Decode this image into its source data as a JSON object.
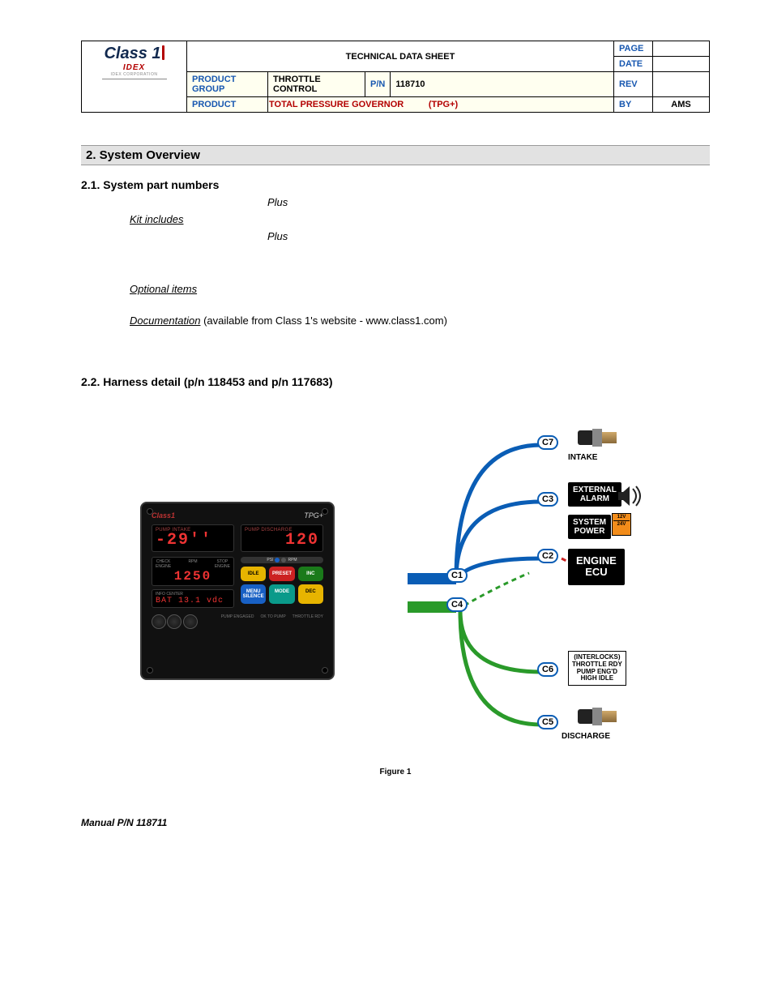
{
  "header": {
    "logo_brand": "Class 1",
    "logo_sub_brand": "IDEX",
    "logo_sub_tag": "IDEX CORPORATION",
    "title": "TECHNICAL DATA SHEET",
    "page_label": "PAGE",
    "page_value": "",
    "date_label": "DATE",
    "date_value": "",
    "product_group_label": "PRODUCT GROUP",
    "product_group_value": "THROTTLE CONTROL",
    "pn_label": "P/N",
    "pn_value": "118710",
    "rev_label": "REV",
    "rev_value": "",
    "product_label": "PRODUCT",
    "product_value_main": "TOTAL PRESSURE GOVERNOR",
    "product_value_suffix": "(TPG+)",
    "by_label": "BY",
    "by_value": "AMS"
  },
  "sections": {
    "overview_heading": "2.  System Overview",
    "part_numbers_heading": "2.1.   System part numbers",
    "plus1": "Plus",
    "kit_includes": "Kit includes",
    "plus2": "Plus",
    "optional_items": "Optional items",
    "documentation_label": "Documentation",
    "documentation_note": "  (available from Class 1's website -  www.class1.com)",
    "harness_heading": "2.2.   Harness detail (p/n 118453 and p/n 117683)"
  },
  "panel": {
    "brand": "Class1",
    "model": "TPG+",
    "lcd1_label": "PUMP INTAKE",
    "lcd1_value": "-29''",
    "lcd2_label": "PUMP DISCHARGE",
    "lcd2_value": "120",
    "rpm_label_left": "CHECK\\nENGINE",
    "rpm_tiny_left": "PSI",
    "rpm_tiny_right": "RPM",
    "rpm_caption": "RPM",
    "rpm_value": "1250",
    "rpm_label_right": "STOP\\nENGINE",
    "info_caption": "INFO CENTER",
    "info_value": "BAT 13.1 vdc",
    "btn_idle": "IDLE",
    "btn_preset": "PRESET",
    "btn_inc": "INC",
    "btn_menu": "MENU\\nSILENCE",
    "btn_mode": "MODE",
    "btn_dec": "DEC",
    "bot1": "PUMP ENGAGED",
    "bot2": "OK TO PUMP",
    "bot3": "THROTTLE RDY"
  },
  "diagram": {
    "c1": "C1",
    "c2": "C2",
    "c3": "C3",
    "c4": "C4",
    "c5": "C5",
    "c6": "C6",
    "c7": "C7",
    "intake": "INTAKE",
    "ext_alarm": "EXTERNAL\\nALARM",
    "sys_power": "SYSTEM\\nPOWER",
    "engine_ecu": "ENGINE\\nECU",
    "interlocks": "(INTERLOCKS)\\nTHROTTLE RDY\\nPUMP ENG'D\\nHIGH IDLE",
    "discharge": "DISCHARGE",
    "v12": "12V",
    "v24": "24V"
  },
  "figure_caption": "Figure 1",
  "footer": "Manual P/N 118711"
}
